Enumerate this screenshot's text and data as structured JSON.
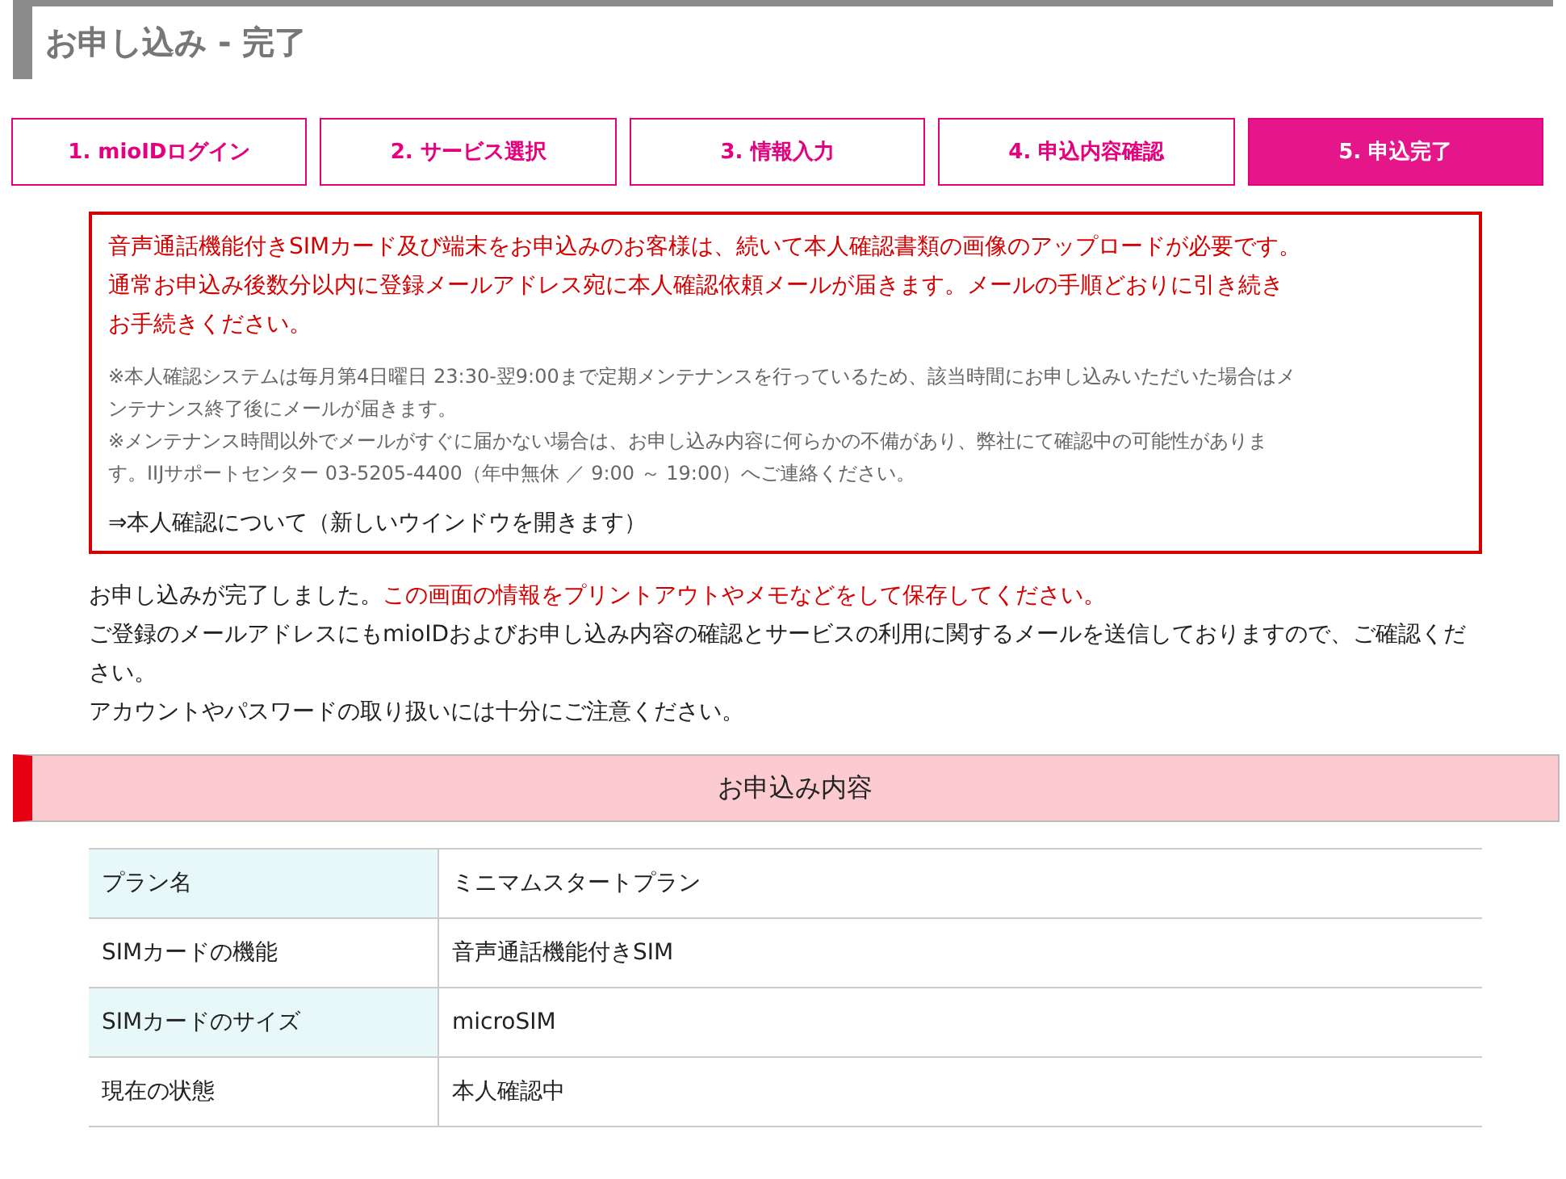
{
  "page_title": "お申し込み - 完了",
  "steps": [
    {
      "label": "1. mioIDログイン",
      "selected": false
    },
    {
      "label": "2. サービス選択",
      "selected": false
    },
    {
      "label": "3. 情報入力",
      "selected": false
    },
    {
      "label": "4. 申込内容確認",
      "selected": false
    },
    {
      "label": "5. 申込完了",
      "selected": true
    }
  ],
  "notice": {
    "important": [
      "音声通話機能付きSIMカード及び端末をお申込みのお客様は、続いて本人確認書類の画像のアップロードが必要です。",
      "通常お申込み後数分以内に登録メールアドレス宛に本人確認依頼メールが届きます。メールの手順どおりに引き続きお手続きください。"
    ],
    "notes": [
      "※本人確認システムは毎月第4日曜日 23:30-翌9:00まで定期メンテナンスを行っているため、該当時間にお申し込みいただいた場合はメンテナンス終了後にメールが届きます。",
      "※メンテナンス時間以外でメールがすぐに届かない場合は、お申し込み内容に何らかの不備があり、弊社にて確認中の可能性があります。IIJサポートセンター 03-5205-4400（年中無休 ／ 9:00 ～ 19:00）へご連絡ください。"
    ],
    "link": "⇒本人確認について（新しいウインドウを開きます）"
  },
  "completion": {
    "first_line": [
      {
        "text": "お申し込みが完了しました。",
        "highlighted": false
      },
      {
        "text": "この画面の情報をプリントアウトやメモなどをして保存してください。",
        "highlighted": true
      }
    ],
    "lines": [
      "ご登録のメールアドレスにもmioIDおよびお申し込み内容の確認とサービスの利用に関するメールを送信しておりますので、ご確認ください。",
      "アカウントやパスワードの取り扱いには十分にご注意ください。"
    ]
  },
  "section_title": "お申込み内容",
  "details": [
    {
      "label": "プラン名",
      "value": "ミニマムスタートプラン"
    },
    {
      "label": "SIMカードの機能",
      "value": "音声通話機能付きSIM"
    },
    {
      "label": "SIMカードのサイズ",
      "value": "microSIM"
    },
    {
      "label": "現在の状態",
      "value": "本人確認中"
    }
  ]
}
